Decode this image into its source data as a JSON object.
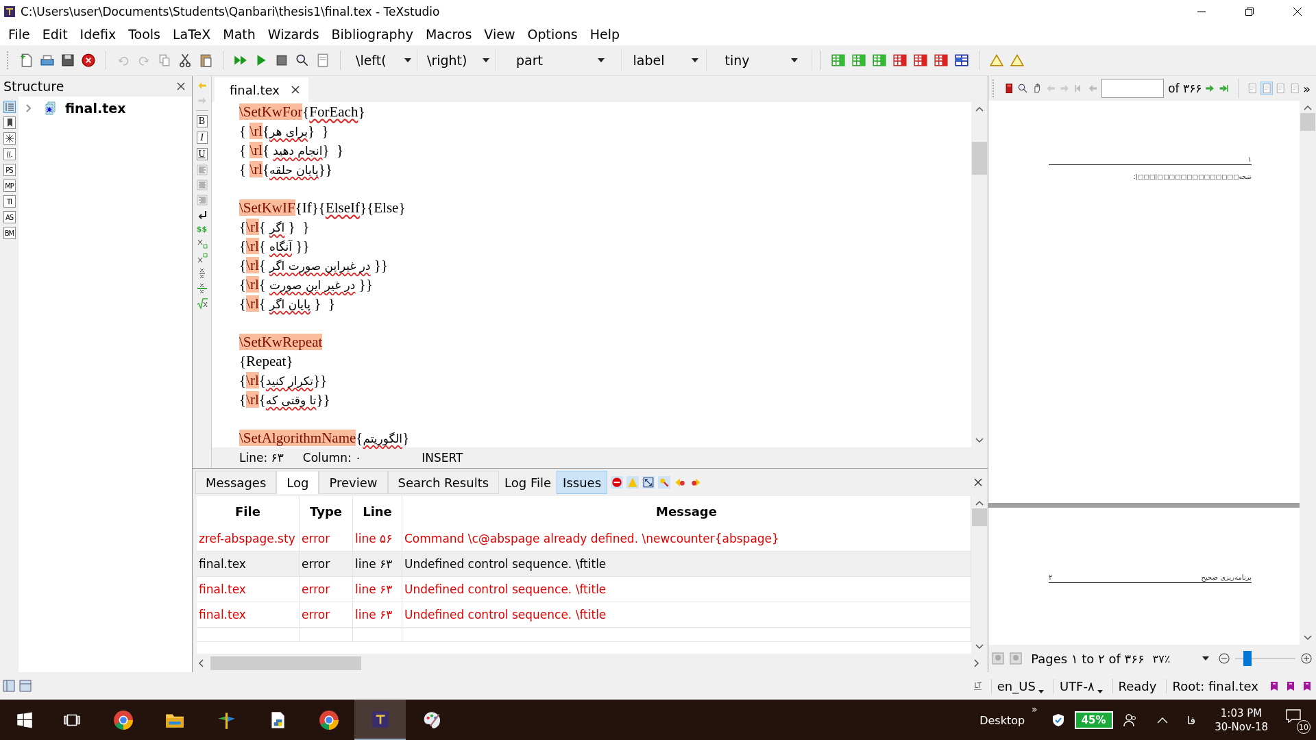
{
  "window": {
    "title": "C:\\Users\\user\\Documents\\Students\\Qanbari\\thesis1\\final.tex - TeXstudio"
  },
  "menu": [
    "File",
    "Edit",
    "Idefix",
    "Tools",
    "LaTeX",
    "Math",
    "Wizards",
    "Bibliography",
    "Macros",
    "View",
    "Options",
    "Help"
  ],
  "toolbar": {
    "combos": [
      {
        "value": "\\left("
      },
      {
        "value": "\\right)"
      },
      {
        "value": "part"
      },
      {
        "value": "label"
      },
      {
        "value": "tiny"
      }
    ]
  },
  "structure": {
    "title": "Structure",
    "side_buttons": [
      {
        "kind": "outline",
        "selected": true
      },
      {
        "kind": "bookmark",
        "selected": false
      },
      {
        "kind": "asterisk",
        "selected": false
      },
      {
        "kind": "label",
        "label": "((.",
        "selected": false
      },
      {
        "kind": "label",
        "label": "PS",
        "selected": false
      },
      {
        "kind": "label",
        "label": "MP",
        "selected": false
      },
      {
        "kind": "label",
        "label": "TI",
        "selected": false
      },
      {
        "kind": "label",
        "label": "AS",
        "selected": false
      },
      {
        "kind": "label",
        "label": "BM",
        "selected": false
      }
    ],
    "tree": [
      {
        "label": "final.tex",
        "expanded": false
      }
    ]
  },
  "editor": {
    "tabs": [
      {
        "label": "final.tex",
        "selected": true
      }
    ],
    "side_buttons": [
      {
        "kind": "letter",
        "label": "B"
      },
      {
        "kind": "letter",
        "label": "I"
      },
      {
        "kind": "letter",
        "label": "U"
      },
      {
        "kind": "align-left"
      },
      {
        "kind": "align-center"
      },
      {
        "kind": "align-right"
      },
      {
        "kind": "newline"
      },
      {
        "kind": "math",
        "label": "$$"
      },
      {
        "kind": "subscript"
      },
      {
        "kind": "superscript"
      },
      {
        "kind": "fraction"
      },
      {
        "kind": "fraction-bar"
      },
      {
        "kind": "root"
      }
    ],
    "blocks": [
      {
        "lines": [
          {
            "segments": [
              {
                "kind": "cmd",
                "text": "\\SetKwFor",
                "misspelled": false
              },
              {
                "kind": "text",
                "text": "{",
                "misspelled": false
              },
              {
                "kind": "text",
                "text": "ForEach",
                "misspelled": true
              },
              {
                "kind": "text",
                "text": "}",
                "misspelled": false
              }
            ]
          },
          {
            "segments": [
              {
                "kind": "text",
                "text": "{ ",
                "misspelled": false
              },
              {
                "kind": "cmd",
                "text": "\\rl",
                "misspelled": false
              },
              {
                "kind": "text",
                "text": "{",
                "misspelled": false
              },
              {
                "kind": "rtl",
                "text": "برای هر",
                "misspelled": true
              },
              {
                "kind": "text",
                "text": "}  }",
                "misspelled": false
              }
            ]
          },
          {
            "segments": [
              {
                "kind": "text",
                "text": "{ ",
                "misspelled": false
              },
              {
                "kind": "cmd",
                "text": "\\rl",
                "misspelled": false
              },
              {
                "kind": "text",
                "text": "{ ",
                "misspelled": false
              },
              {
                "kind": "rtl",
                "text": "انجام دهید",
                "misspelled": true
              },
              {
                "kind": "text",
                "text": "}  }",
                "misspelled": false
              }
            ]
          },
          {
            "segments": [
              {
                "kind": "text",
                "text": "{ ",
                "misspelled": false
              },
              {
                "kind": "cmd",
                "text": "\\rl",
                "misspelled": false
              },
              {
                "kind": "text",
                "text": "{",
                "misspelled": false
              },
              {
                "kind": "rtl",
                "text": "پایان حلقه",
                "misspelled": true
              },
              {
                "kind": "text",
                "text": "}}",
                "misspelled": false
              }
            ]
          }
        ]
      },
      {
        "lines": [
          {
            "segments": [
              {
                "kind": "cmd",
                "text": "\\SetKwIF",
                "misspelled": false
              },
              {
                "kind": "text",
                "text": "{If}{",
                "misspelled": false
              },
              {
                "kind": "text",
                "text": "ElseIf",
                "misspelled": true
              },
              {
                "kind": "text",
                "text": "}{Else}",
                "misspelled": false
              }
            ]
          },
          {
            "segments": [
              {
                "kind": "text",
                "text": "{",
                "misspelled": false
              },
              {
                "kind": "cmd",
                "text": "\\rl",
                "misspelled": false
              },
              {
                "kind": "text",
                "text": "{ ",
                "misspelled": false
              },
              {
                "kind": "rtl",
                "text": "اگر",
                "misspelled": true
              },
              {
                "kind": "text",
                "text": " }  }",
                "misspelled": false
              }
            ]
          },
          {
            "segments": [
              {
                "kind": "text",
                "text": "{",
                "misspelled": false
              },
              {
                "kind": "cmd",
                "text": "\\rl",
                "misspelled": false
              },
              {
                "kind": "text",
                "text": "{ ",
                "misspelled": false
              },
              {
                "kind": "rtl",
                "text": "آنگاه",
                "misspelled": true
              },
              {
                "kind": "text",
                "text": " }}",
                "misspelled": false
              }
            ]
          },
          {
            "segments": [
              {
                "kind": "text",
                "text": "{",
                "misspelled": false
              },
              {
                "kind": "cmd",
                "text": "\\rl",
                "misspelled": false
              },
              {
                "kind": "text",
                "text": "{ ",
                "misspelled": false
              },
              {
                "kind": "rtl",
                "text": "در غیراین صورت اگر",
                "misspelled": true
              },
              {
                "kind": "text",
                "text": " }}",
                "misspelled": false
              }
            ]
          },
          {
            "segments": [
              {
                "kind": "text",
                "text": "{",
                "misspelled": false
              },
              {
                "kind": "cmd",
                "text": "\\rl",
                "misspelled": false
              },
              {
                "kind": "text",
                "text": "{ ",
                "misspelled": false
              },
              {
                "kind": "rtl",
                "text": "در غیر این صورت",
                "misspelled": true
              },
              {
                "kind": "text",
                "text": " }}",
                "misspelled": false
              }
            ]
          },
          {
            "segments": [
              {
                "kind": "text",
                "text": "{",
                "misspelled": false
              },
              {
                "kind": "cmd",
                "text": "\\rl",
                "misspelled": false
              },
              {
                "kind": "text",
                "text": "{ ",
                "misspelled": false
              },
              {
                "kind": "rtl",
                "text": "پایان اگر",
                "misspelled": true
              },
              {
                "kind": "text",
                "text": " }  }",
                "misspelled": false
              }
            ]
          }
        ]
      },
      {
        "lines": [
          {
            "segments": [
              {
                "kind": "cmd",
                "text": "\\SetKwRepeat",
                "misspelled": false
              }
            ]
          },
          {
            "segments": [
              {
                "kind": "text",
                "text": "{Repeat}",
                "misspelled": false
              }
            ]
          },
          {
            "segments": [
              {
                "kind": "text",
                "text": "{",
                "misspelled": false
              },
              {
                "kind": "cmd",
                "text": "\\rl",
                "misspelled": false
              },
              {
                "kind": "text",
                "text": "{",
                "misspelled": false
              },
              {
                "kind": "rtl",
                "text": "تکرار کنید",
                "misspelled": true
              },
              {
                "kind": "text",
                "text": "}}",
                "misspelled": false
              }
            ]
          },
          {
            "segments": [
              {
                "kind": "text",
                "text": "{",
                "misspelled": false
              },
              {
                "kind": "cmd",
                "text": "\\rl",
                "misspelled": false
              },
              {
                "kind": "text",
                "text": "{",
                "misspelled": false
              },
              {
                "kind": "rtl",
                "text": "تا وقتی که",
                "misspelled": true
              },
              {
                "kind": "text",
                "text": "}}",
                "misspelled": false
              }
            ]
          }
        ]
      },
      {
        "lines": [
          {
            "segments": [
              {
                "kind": "cmd",
                "text": "\\SetAlgorithmName",
                "misspelled": false
              },
              {
                "kind": "text",
                "text": "{",
                "misspelled": false
              },
              {
                "kind": "rtl",
                "text": "الگوریتم",
                "misspelled": true
              },
              {
                "kind": "text",
                "text": "}",
                "misspelled": false
              }
            ]
          }
        ]
      }
    ],
    "status": {
      "line": "Line: ۶۳",
      "column": "Column: ۰",
      "mode": "INSERT"
    }
  },
  "log_panel": {
    "tabs": [
      {
        "label": "Messages",
        "selected": false
      },
      {
        "label": "Log",
        "selected": true
      },
      {
        "label": "Preview",
        "selected": false
      },
      {
        "label": "Search Results",
        "selected": false
      }
    ],
    "tools": [
      {
        "label": "Log File",
        "selected": false
      },
      {
        "label": "Issues",
        "selected": true
      }
    ],
    "columns": [
      "File",
      "Type",
      "Line",
      "Message"
    ],
    "rows": [
      {
        "file": "zref-abspage.sty",
        "type": "error",
        "line": "line ۵۶",
        "message": "Command \\c@abspage already defined. \\newcounter{abspage}",
        "selected": false
      },
      {
        "file": "final.tex",
        "type": "error",
        "line": "line ۶۳",
        "message": "Undefined control sequence. \\ftitle",
        "selected": true
      },
      {
        "file": "final.tex",
        "type": "error",
        "line": "line ۶۳",
        "message": "Undefined control sequence. \\ftitle",
        "selected": false
      },
      {
        "file": "final.tex",
        "type": "error",
        "line": "line ۶۳",
        "message": "Undefined control sequence. \\ftitle",
        "selected": false
      }
    ]
  },
  "pdf": {
    "page_total": "of ۳۶۶",
    "overflow": "»",
    "view_modes": [
      {
        "selected": false
      },
      {
        "selected": true
      },
      {
        "selected": false
      },
      {
        "selected": false
      }
    ],
    "pages": [
      {
        "number": "۱",
        "text": "نتیجه□□□□□□□□□□□□□□|□□□|:"
      },
      {
        "number": "۲",
        "header": "برنامه‌ریزی صحیح"
      }
    ],
    "footer": {
      "pages": "Pages ۱ to ۲ of ۳۶۶",
      "zoom": "۳۷٪",
      "level": 0.2
    }
  },
  "status_bar": {
    "language_tool": "LT",
    "items": [
      {
        "label": "en_US",
        "dropdown": true
      },
      {
        "label": "UTF-۸",
        "dropdown": true
      },
      {
        "label": "Ready",
        "dropdown": false
      },
      {
        "label": "Root: final.tex",
        "dropdown": false
      }
    ]
  },
  "taskbar": {
    "apps": [
      {
        "kind": "chrome",
        "selected": false
      },
      {
        "kind": "folder",
        "selected": false
      },
      {
        "kind": "figure",
        "selected": false
      },
      {
        "kind": "script",
        "selected": false
      },
      {
        "kind": "chrome",
        "selected": false
      },
      {
        "kind": "tex",
        "selected": true
      },
      {
        "kind": "palette",
        "selected": false
      }
    ],
    "tray": {
      "desktop": "Desktop",
      "overflow": "»",
      "battery": "45%",
      "ime": "فا",
      "time": "1:03 PM",
      "date": "30-Nov-18",
      "notifications": "10"
    }
  }
}
